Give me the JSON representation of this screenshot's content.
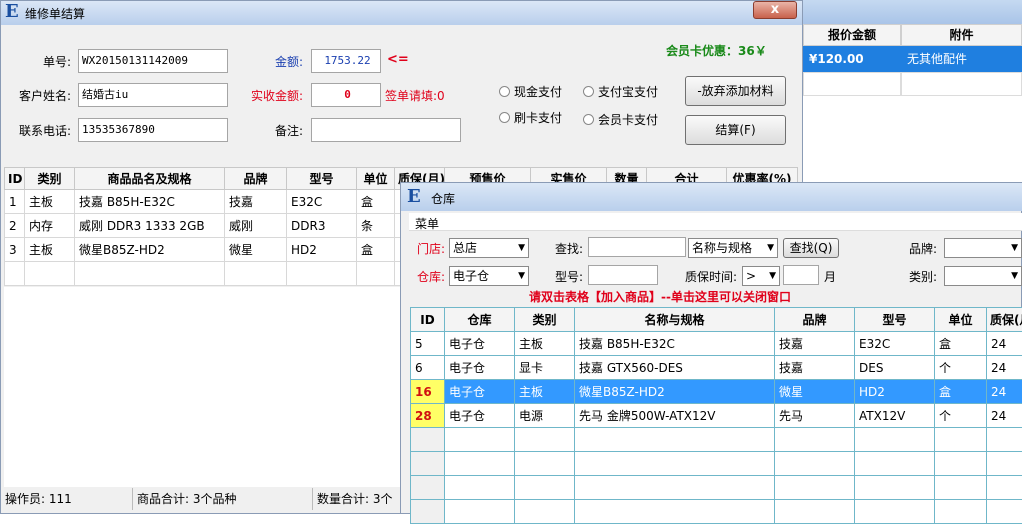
{
  "bg_window": {
    "headers": [
      "报价金额",
      "附件"
    ],
    "row": {
      "amount": "¥120.00",
      "attachment": "无其他配件"
    }
  },
  "main": {
    "title": "维修单结算",
    "close_label": "x",
    "order_no_label": "单号:",
    "order_no": "WX20150131142009",
    "amount_label": "金额:",
    "amount": "1753.22",
    "amount_compare": "<=",
    "member_discount": "会员卡优惠：36￥",
    "customer_label": "客户姓名:",
    "customer_name": "结婚古iu",
    "actual_label": "实收金额:",
    "actual_amount": "0",
    "sign_label": "签单请填:0",
    "phone_label": "联系电话:",
    "phone": "13535367890",
    "note_label": "备注:",
    "note": "",
    "pay_options": [
      "现金支付",
      "支付宝支付",
      "刷卡支付",
      "会员卡支付"
    ],
    "abandon_button": "-放弃添加材料",
    "settle_button": "结算(F)",
    "table": {
      "headers": [
        "ID",
        "类别",
        "商品品名及规格",
        "品牌",
        "型号",
        "单位",
        "质保(月)",
        "预售价",
        "实售价",
        "数量",
        "合计",
        "优惠率(%)"
      ],
      "rows": [
        [
          "1",
          "主板",
          "技嘉 B85H-E32C",
          "技嘉",
          "E32C",
          "盒"
        ],
        [
          "2",
          "内存",
          "威刚 DDR3 1333 2GB",
          "威刚",
          "DDR3",
          "条"
        ],
        [
          "3",
          "主板",
          "微星B85Z-HD2",
          "微星",
          "HD2",
          "盒"
        ]
      ]
    },
    "status": {
      "operator": "操作员: 111",
      "item_total": "商品合计: 3个品种",
      "qty_total": "数量合计: 3个"
    }
  },
  "warehouse": {
    "title": "仓库",
    "menu": "菜单",
    "store_label": "门店:",
    "store_value": "总店",
    "search_label": "查找:",
    "search_value": "",
    "search_mode": "名称与规格",
    "search_button": "查找(Q)",
    "brand_label": "品牌:",
    "brand_value": "",
    "depot_label": "仓库:",
    "depot_value": "电子仓",
    "model_label": "型号:",
    "model_value": "",
    "warranty_label": "质保时间:",
    "warranty_op": ">",
    "warranty_value": "",
    "warranty_unit": "月",
    "category_label": "类别:",
    "category_value": "",
    "hint": "请双击表格【加入商品】--单击这里可以关闭窗口",
    "table": {
      "headers": [
        "ID",
        "仓库",
        "类别",
        "名称与规格",
        "品牌",
        "型号",
        "单位",
        "质保(月)"
      ],
      "rows": [
        [
          "5",
          "电子仓",
          "主板",
          "技嘉 B85H-E32C",
          "技嘉",
          "E32C",
          "盒",
          "24"
        ],
        [
          "6",
          "电子仓",
          "显卡",
          "技嘉 GTX560-DES",
          "技嘉",
          "DES",
          "个",
          "24"
        ],
        [
          "16",
          "电子仓",
          "主板",
          "微星B85Z-HD2",
          "微星",
          "HD2",
          "盒",
          "24"
        ],
        [
          "28",
          "电子仓",
          "电源",
          "先马 金牌500W-ATX12V",
          "先马",
          "ATX12V",
          "个",
          "24"
        ]
      ]
    }
  },
  "colors": {
    "accent_red": "#e0001a",
    "green": "#1a8a1a",
    "select_blue": "#3399ff",
    "id_yellow": "#ffff66"
  }
}
